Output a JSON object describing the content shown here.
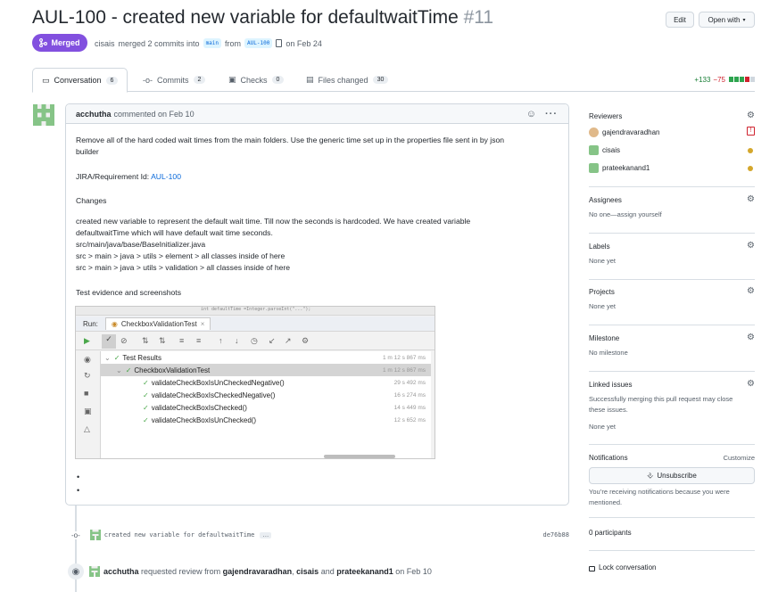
{
  "header": {
    "title": "AUL-100 - created new variable for defaultwaitTime",
    "number": "#11",
    "edit_label": "Edit",
    "open_with_label": "Open with",
    "status": "Merged",
    "author": "cisais",
    "merge_text": "merged 2 commits into",
    "base_branch": "main",
    "from_text": "from",
    "head_branch": "AUL-100",
    "date_text": "on Feb 24"
  },
  "tabs": [
    {
      "label": "Conversation",
      "count": "6"
    },
    {
      "label": "Commits",
      "count": "2"
    },
    {
      "label": "Checks",
      "count": "0"
    },
    {
      "label": "Files changed",
      "count": "30"
    }
  ],
  "diffstat": {
    "additions": "+133",
    "deletions": "−75"
  },
  "comment": {
    "author": "acchutha",
    "meta": "commented on Feb 10",
    "para1_line1": "Remove all of the hard coded wait times from the main folders. Use the generic time set up in the properties file sent in by json",
    "para1_line2": "builder",
    "jira_label": "JIRA/Requirement Id:",
    "jira_link": "AUL-100",
    "changes_heading": "Changes",
    "changes_line1": "created new variable to represent the default wait time. Till now the seconds is hardcoded. We have created variable",
    "changes_line2": "defaultwaitTime which will have default wait time seconds.",
    "changes_line3": "src/main/java/base/BaseInitializer.java",
    "changes_line4": "src > main > java > utils > element > all classes inside of here",
    "changes_line5": "src > main > java > utils > validation > all classes inside of here",
    "evidence_heading": "Test evidence and screenshots"
  },
  "ide": {
    "top_code": "int defaultTime =Integer.parseInt(\"...\");",
    "run_label": "Run:",
    "run_tab": "CheckboxValidationTest",
    "tree": [
      {
        "label": "Test Results",
        "time": "1 m 12 s 867 ms"
      },
      {
        "label": "CheckboxValidationTest",
        "time": "1 m 12 s 867 ms"
      },
      {
        "label": "validateCheckBoxIsUnCheckedNegative()",
        "time": "29 s 492 ms"
      },
      {
        "label": "validateCheckBoxIsCheckedNegative()",
        "time": "16 s 274 ms"
      },
      {
        "label": "validateCheckBoxIsChecked()",
        "time": "14 s 449 ms"
      },
      {
        "label": "validateCheckBoxIsUnChecked()",
        "time": "12 s 652 ms"
      }
    ]
  },
  "timeline": {
    "commit_message": "created new variable for defaultwaitTime",
    "commit_more": "…",
    "commit_sha": "de76b88",
    "review_author": "acchutha",
    "review_text1": "requested review from",
    "reviewer1": "gajendravaradhan",
    "review_sep": ",",
    "reviewer2": "cisais",
    "review_and": "and",
    "reviewer3": "prateekanand1",
    "review_date": "on Feb 10"
  },
  "sidebar": {
    "reviewers_title": "Reviewers",
    "reviewers": [
      "gajendravaradhan",
      "cisais",
      "prateekanand1"
    ],
    "assignees_title": "Assignees",
    "assignees_value": "No one—assign yourself",
    "labels_title": "Labels",
    "labels_value": "None yet",
    "projects_title": "Projects",
    "projects_value": "None yet",
    "milestone_title": "Milestone",
    "milestone_value": "No milestone",
    "linked_title": "Linked issues",
    "linked_desc1": "Successfully merging this pull request may close",
    "linked_desc2": "these issues.",
    "linked_value": "None yet",
    "notifications_title": "Notifications",
    "customize_label": "Customize",
    "unsubscribe_label": "Unsubscribe",
    "notif_desc1": "You’re receiving notifications because you were",
    "notif_desc2": "mentioned.",
    "participants": "0 participants",
    "lock_label": "Lock conversation"
  },
  "colors": {
    "merged": "#8250df",
    "link": "#0969da",
    "add": "#1a7f37",
    "del": "#cf222e",
    "pending": "#d4a72c"
  }
}
